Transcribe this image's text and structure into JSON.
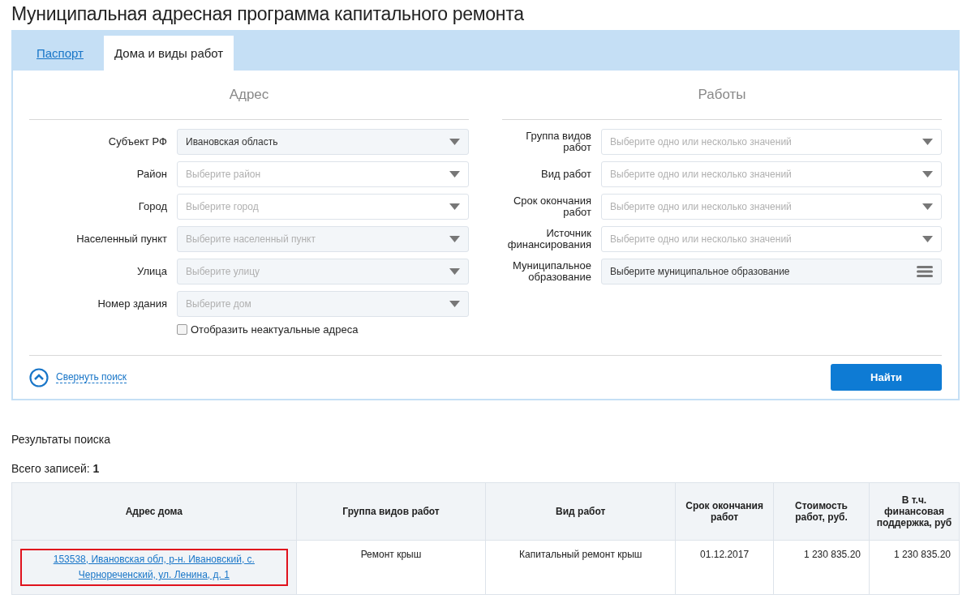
{
  "page_title": "Муниципальная адресная программа капитального ремонта",
  "tabs": [
    {
      "label": "Паспорт",
      "selected": false
    },
    {
      "label": "Дома и виды работ",
      "selected": true
    }
  ],
  "address_section": {
    "heading": "Адрес",
    "fields": [
      {
        "label": "Субъект РФ",
        "kind": "select",
        "value": "Ивановская область",
        "disabled": true
      },
      {
        "label": "Район",
        "kind": "select",
        "placeholder": "Выберите район",
        "disabled": false
      },
      {
        "label": "Город",
        "kind": "select",
        "placeholder": "Выберите город",
        "disabled": false
      },
      {
        "label": "Населенный пункт",
        "kind": "select",
        "placeholder": "Выберите населенный пункт",
        "disabled": true
      },
      {
        "label": "Улица",
        "kind": "select",
        "placeholder": "Выберите улицу",
        "disabled": true
      },
      {
        "label": "Номер здания",
        "kind": "select",
        "placeholder": "Выберите дом",
        "disabled": true
      }
    ],
    "checkbox": {
      "label": "Отобразить неактуальные адреса",
      "checked": false
    }
  },
  "works_section": {
    "heading": "Работы",
    "fields": [
      {
        "label": "Группа видов работ",
        "kind": "select",
        "placeholder": "Выберите одно или несколько значений",
        "disabled": false
      },
      {
        "label": "Вид работ",
        "kind": "select",
        "placeholder": "Выберите одно или несколько значений",
        "disabled": false
      },
      {
        "label": "Срок окончания работ",
        "kind": "select",
        "placeholder": "Выберите одно или несколько значений",
        "disabled": false
      },
      {
        "label": "Источник финансирования",
        "kind": "select",
        "placeholder": "Выберите одно или несколько значений",
        "disabled": false
      },
      {
        "label": "Муниципальное образование",
        "kind": "list",
        "value": "Выберите муниципальное образование",
        "disabled": true
      }
    ]
  },
  "collapse_link": "Свернуть поиск",
  "search_button": "Найти",
  "results_title": "Результаты поиска",
  "total": {
    "label": "Всего записей:",
    "count": "1"
  },
  "table": {
    "columns": [
      "Адрес дома",
      "Группа видов работ",
      "Вид работ",
      "Срок окончания работ",
      "Стоимость работ, руб.",
      "В т.ч. финансовая поддержка, руб"
    ],
    "rows": [
      {
        "highlighted": true,
        "cells": [
          "153538, Ивановская обл, р-н. Ивановский, с. Чернореченский, ул. Ленина, д. 1",
          "Ремонт крыш",
          "Капитальный ремонт крыш",
          "01.12.2017",
          "1 230 835.20",
          "1 230 835.20"
        ]
      }
    ]
  }
}
